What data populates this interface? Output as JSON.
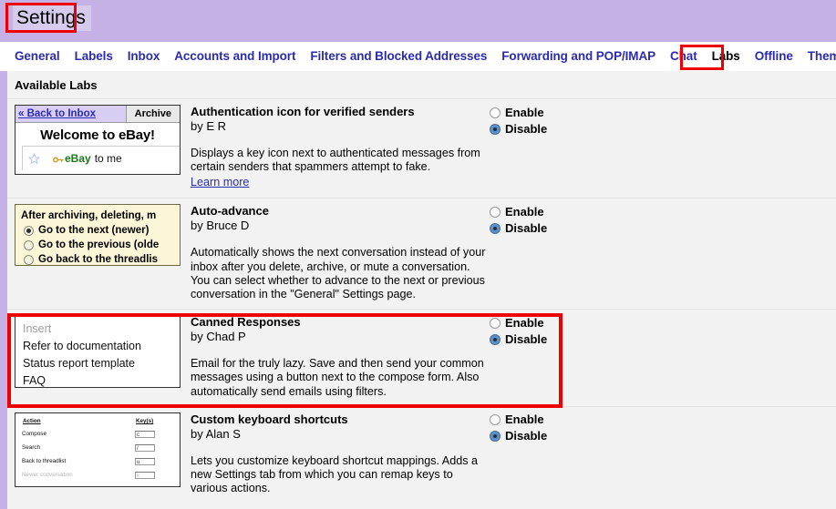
{
  "header": {
    "title": "Settings"
  },
  "tabs": [
    {
      "label": "General",
      "active": false
    },
    {
      "label": "Labels",
      "active": false
    },
    {
      "label": "Inbox",
      "active": false
    },
    {
      "label": "Accounts and Import",
      "active": false
    },
    {
      "label": "Filters and Blocked Addresses",
      "active": false
    },
    {
      "label": "Forwarding and POP/IMAP",
      "active": false
    },
    {
      "label": "Chat",
      "active": false
    },
    {
      "label": "Labs",
      "active": true
    },
    {
      "label": "Offline",
      "active": false
    },
    {
      "label": "Themes",
      "active": false
    }
  ],
  "main": {
    "section_title": "Available Labs"
  },
  "labs": [
    {
      "title": "Authentication icon for verified senders",
      "author": "by E R",
      "description": "Displays a key icon next to authenticated messages from certain senders that spammers attempt to fake.",
      "learn_more": "Learn more",
      "enable_label": "Enable",
      "disable_label": "Disable",
      "selected": "Disable"
    },
    {
      "title": "Auto-advance",
      "author": "by Bruce D",
      "description": "Automatically shows the next conversation instead of your inbox after you delete, archive, or mute a conversation. You can select whether to advance to the next or previous conversation in the \"General\" Settings page.",
      "learn_more": "",
      "enable_label": "Enable",
      "disable_label": "Disable",
      "selected": "Disable"
    },
    {
      "title": "Canned Responses",
      "author": "by Chad P",
      "description": "Email for the truly lazy. Save and then send your common messages using a button next to the compose form. Also automatically send emails using filters.",
      "learn_more": "",
      "enable_label": "Enable",
      "disable_label": "Disable",
      "selected": "Disable"
    },
    {
      "title": "Custom keyboard shortcuts",
      "author": "by Alan S",
      "description": "Lets you customize keyboard shortcut mappings. Adds a new Settings tab from which you can remap keys to various actions.",
      "learn_more": "",
      "enable_label": "Enable",
      "disable_label": "Disable",
      "selected": "Disable"
    }
  ],
  "previews": {
    "ebay": {
      "back_link": "« Back to Inbox",
      "archive_button": "Archive",
      "welcome": "Welcome to eBay!",
      "sender": "eBay",
      "recipient": "to me"
    },
    "auto_advance": {
      "heading": "After archiving, deleting, m",
      "options": [
        {
          "label": "Go to the next (newer)",
          "selected": true
        },
        {
          "label": "Go to the previous (olde",
          "selected": false
        },
        {
          "label": "Go back to the threadlis",
          "selected": false
        }
      ]
    },
    "canned": {
      "heading": "Insert",
      "items": [
        "Refer to documentation",
        "Status report template",
        "FAQ"
      ]
    },
    "keyboard": {
      "col_action": "Action",
      "col_keys": "Key(s)",
      "rows": [
        {
          "action": "Compose",
          "key": "c",
          "muted": false
        },
        {
          "action": "Search",
          "key": "/",
          "muted": false
        },
        {
          "action": "Back to threadlist",
          "key": "u",
          "muted": false
        },
        {
          "action": "Newer conversation",
          "key": "k",
          "muted": true
        }
      ]
    }
  },
  "annotations": {
    "accent_color": "#ee0000",
    "header_color": "#c5b1e6",
    "link_color": "#2b2bb0"
  }
}
